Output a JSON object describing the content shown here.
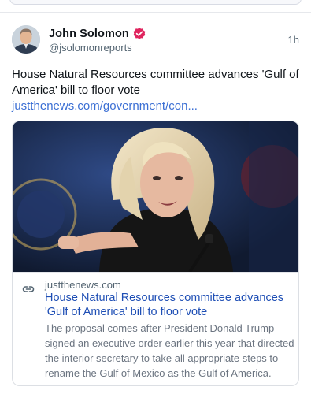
{
  "post": {
    "author": {
      "display_name": "John Solomon",
      "handle": "@jsolomonreports",
      "verified_color": "#e0245e"
    },
    "timestamp": "1h",
    "text": "House Natural Resources committee advances 'Gulf of America' bill to floor vote",
    "link_text": "justthenews.com/government/con..."
  },
  "link_card": {
    "domain": "justthenews.com",
    "title": "House Natural Resources committee advances 'Gulf of America' bill to floor vote",
    "description": "The proposal comes after President Donald Trump signed an executive order earlier this year that directed the interior secretary to take all appropriate steps to rename the Gulf of Mexico as the Gulf of America.",
    "link_icon": "link-icon"
  },
  "colors": {
    "link": "#3b6fd4",
    "card_title": "#1f4fb5",
    "secondary_text": "#536471"
  }
}
